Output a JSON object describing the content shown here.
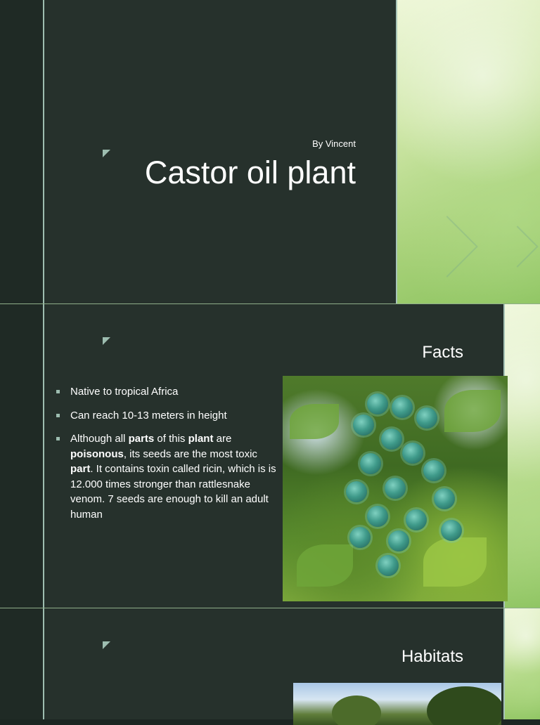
{
  "slide1": {
    "byline": "By Vincent",
    "title": "Castor oil plant"
  },
  "slide2": {
    "heading": "Facts",
    "bullets": [
      [
        {
          "t": "Native to tropical Africa",
          "b": false
        }
      ],
      [
        {
          "t": "Can reach 10-13 meters in height",
          "b": false
        }
      ],
      [
        {
          "t": "Although all ",
          "b": false
        },
        {
          "t": "parts",
          "b": true
        },
        {
          "t": " of this ",
          "b": false
        },
        {
          "t": "plant",
          "b": true
        },
        {
          "t": " are ",
          "b": false
        },
        {
          "t": "poisonous",
          "b": true
        },
        {
          "t": ", its seeds are the most toxic ",
          "b": false
        },
        {
          "t": "part",
          "b": true
        },
        {
          "t": ". It contains toxin called ricin, which is  is 12.000 times stronger than rattlesnake venom. 7 seeds are enough to kill an adult human",
          "b": false
        }
      ]
    ]
  },
  "slide3": {
    "heading": "Habitats"
  },
  "colors": {
    "slide_bg": "#26312c",
    "rail": "#1f2a25",
    "accent_line": "#9dbdb0",
    "green_panel": "#a9d27a",
    "text": "#ffffff"
  },
  "icons": {
    "slide_marker": "triangle-marker-icon",
    "bullet": "square-bullet-icon"
  }
}
